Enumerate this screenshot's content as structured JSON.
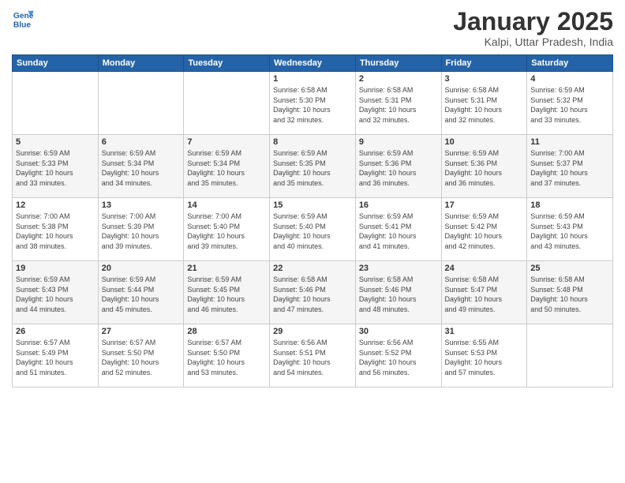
{
  "logo": {
    "line1": "General",
    "line2": "Blue"
  },
  "title": "January 2025",
  "subtitle": "Kalpi, Uttar Pradesh, India",
  "days_of_week": [
    "Sunday",
    "Monday",
    "Tuesday",
    "Wednesday",
    "Thursday",
    "Friday",
    "Saturday"
  ],
  "weeks": [
    [
      {
        "day": "",
        "info": ""
      },
      {
        "day": "",
        "info": ""
      },
      {
        "day": "",
        "info": ""
      },
      {
        "day": "1",
        "info": "Sunrise: 6:58 AM\nSunset: 5:30 PM\nDaylight: 10 hours\nand 32 minutes."
      },
      {
        "day": "2",
        "info": "Sunrise: 6:58 AM\nSunset: 5:31 PM\nDaylight: 10 hours\nand 32 minutes."
      },
      {
        "day": "3",
        "info": "Sunrise: 6:58 AM\nSunset: 5:31 PM\nDaylight: 10 hours\nand 32 minutes."
      },
      {
        "day": "4",
        "info": "Sunrise: 6:59 AM\nSunset: 5:32 PM\nDaylight: 10 hours\nand 33 minutes."
      }
    ],
    [
      {
        "day": "5",
        "info": "Sunrise: 6:59 AM\nSunset: 5:33 PM\nDaylight: 10 hours\nand 33 minutes."
      },
      {
        "day": "6",
        "info": "Sunrise: 6:59 AM\nSunset: 5:34 PM\nDaylight: 10 hours\nand 34 minutes."
      },
      {
        "day": "7",
        "info": "Sunrise: 6:59 AM\nSunset: 5:34 PM\nDaylight: 10 hours\nand 35 minutes."
      },
      {
        "day": "8",
        "info": "Sunrise: 6:59 AM\nSunset: 5:35 PM\nDaylight: 10 hours\nand 35 minutes."
      },
      {
        "day": "9",
        "info": "Sunrise: 6:59 AM\nSunset: 5:36 PM\nDaylight: 10 hours\nand 36 minutes."
      },
      {
        "day": "10",
        "info": "Sunrise: 6:59 AM\nSunset: 5:36 PM\nDaylight: 10 hours\nand 36 minutes."
      },
      {
        "day": "11",
        "info": "Sunrise: 7:00 AM\nSunset: 5:37 PM\nDaylight: 10 hours\nand 37 minutes."
      }
    ],
    [
      {
        "day": "12",
        "info": "Sunrise: 7:00 AM\nSunset: 5:38 PM\nDaylight: 10 hours\nand 38 minutes."
      },
      {
        "day": "13",
        "info": "Sunrise: 7:00 AM\nSunset: 5:39 PM\nDaylight: 10 hours\nand 39 minutes."
      },
      {
        "day": "14",
        "info": "Sunrise: 7:00 AM\nSunset: 5:40 PM\nDaylight: 10 hours\nand 39 minutes."
      },
      {
        "day": "15",
        "info": "Sunrise: 6:59 AM\nSunset: 5:40 PM\nDaylight: 10 hours\nand 40 minutes."
      },
      {
        "day": "16",
        "info": "Sunrise: 6:59 AM\nSunset: 5:41 PM\nDaylight: 10 hours\nand 41 minutes."
      },
      {
        "day": "17",
        "info": "Sunrise: 6:59 AM\nSunset: 5:42 PM\nDaylight: 10 hours\nand 42 minutes."
      },
      {
        "day": "18",
        "info": "Sunrise: 6:59 AM\nSunset: 5:43 PM\nDaylight: 10 hours\nand 43 minutes."
      }
    ],
    [
      {
        "day": "19",
        "info": "Sunrise: 6:59 AM\nSunset: 5:43 PM\nDaylight: 10 hours\nand 44 minutes."
      },
      {
        "day": "20",
        "info": "Sunrise: 6:59 AM\nSunset: 5:44 PM\nDaylight: 10 hours\nand 45 minutes."
      },
      {
        "day": "21",
        "info": "Sunrise: 6:59 AM\nSunset: 5:45 PM\nDaylight: 10 hours\nand 46 minutes."
      },
      {
        "day": "22",
        "info": "Sunrise: 6:58 AM\nSunset: 5:46 PM\nDaylight: 10 hours\nand 47 minutes."
      },
      {
        "day": "23",
        "info": "Sunrise: 6:58 AM\nSunset: 5:46 PM\nDaylight: 10 hours\nand 48 minutes."
      },
      {
        "day": "24",
        "info": "Sunrise: 6:58 AM\nSunset: 5:47 PM\nDaylight: 10 hours\nand 49 minutes."
      },
      {
        "day": "25",
        "info": "Sunrise: 6:58 AM\nSunset: 5:48 PM\nDaylight: 10 hours\nand 50 minutes."
      }
    ],
    [
      {
        "day": "26",
        "info": "Sunrise: 6:57 AM\nSunset: 5:49 PM\nDaylight: 10 hours\nand 51 minutes."
      },
      {
        "day": "27",
        "info": "Sunrise: 6:57 AM\nSunset: 5:50 PM\nDaylight: 10 hours\nand 52 minutes."
      },
      {
        "day": "28",
        "info": "Sunrise: 6:57 AM\nSunset: 5:50 PM\nDaylight: 10 hours\nand 53 minutes."
      },
      {
        "day": "29",
        "info": "Sunrise: 6:56 AM\nSunset: 5:51 PM\nDaylight: 10 hours\nand 54 minutes."
      },
      {
        "day": "30",
        "info": "Sunrise: 6:56 AM\nSunset: 5:52 PM\nDaylight: 10 hours\nand 56 minutes."
      },
      {
        "day": "31",
        "info": "Sunrise: 6:55 AM\nSunset: 5:53 PM\nDaylight: 10 hours\nand 57 minutes."
      },
      {
        "day": "",
        "info": ""
      }
    ]
  ]
}
